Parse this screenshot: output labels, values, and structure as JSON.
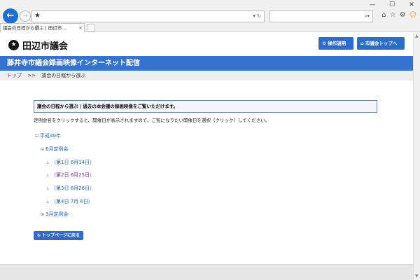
{
  "browser": {
    "tab_title": "議会の日程から選ぶ | 田辺市...",
    "tab_close": "×",
    "address_placeholder": "",
    "address_icons": "▾ ↻",
    "search_icons": "⌕▾",
    "window_controls": [
      "—",
      "☐",
      "✕"
    ]
  },
  "site": {
    "name": "田辺市議会",
    "buttons": {
      "help": "操作説明",
      "top": "市議会トップへ"
    },
    "banner": "藤井寺市議会録画映像インターネット配信"
  },
  "breadcrumb": {
    "top": "トップ",
    "sep": ">>",
    "current": "議会の日程から選ぶ"
  },
  "content": {
    "notice": "議会の日程から選ぶ | 過去の本会議の録画映像をご覧いただけます。",
    "instructions": "定例会名をクリックすると、開催日が表示されますので、ご覧になりたい開催日を選択（クリック）してください。",
    "tree": {
      "year": "平成30年",
      "session_june": "6月定例会",
      "days": [
        {
          "label": "（第1日 6月14日）",
          "visited": false
        },
        {
          "label": "（第2日 6月25日）",
          "visited": true
        },
        {
          "label": "（第3日 6月26日）",
          "visited": false
        },
        {
          "label": "（第4日 7月 6日）",
          "visited": false
        }
      ],
      "session_march": "3月定例会"
    },
    "back_button": "トップページに戻る"
  }
}
